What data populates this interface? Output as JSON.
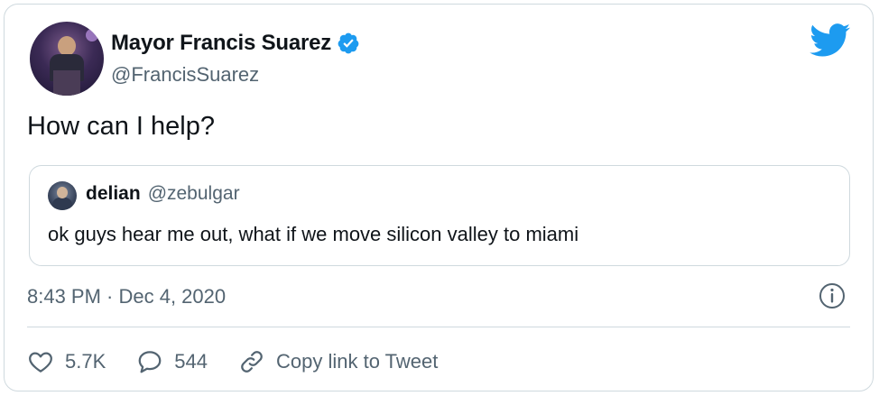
{
  "author": {
    "display_name": "Mayor Francis Suarez",
    "handle": "@FrancisSuarez",
    "verified": true
  },
  "tweet_text": "How can I help?",
  "quoted_tweet": {
    "display_name": "delian",
    "handle": "@zebulgar",
    "text": "ok guys hear me out, what if we move silicon valley to miami"
  },
  "timestamp": "8:43 PM · Dec 4, 2020",
  "actions": {
    "like_count": "5.7K",
    "reply_count": "544",
    "copy_link_label": "Copy link to Tweet"
  },
  "colors": {
    "twitter_blue": "#1d9bf0",
    "text_primary": "#0f1419",
    "text_secondary": "#536471",
    "border": "#cfd9de"
  },
  "icons": [
    "verified-badge-icon",
    "twitter-bird-icon",
    "info-icon",
    "heart-icon",
    "reply-bubble-icon",
    "link-icon"
  ]
}
